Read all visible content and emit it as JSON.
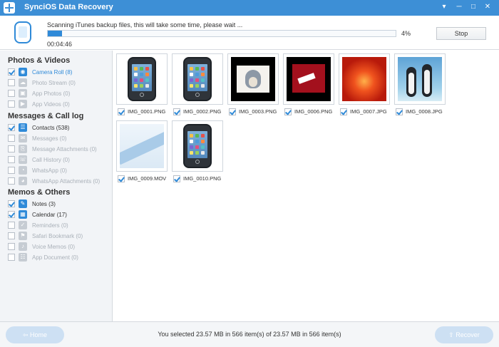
{
  "window": {
    "title": "SynciOS Data Recovery",
    "controls": [
      "▾",
      "─",
      "□",
      "✕"
    ]
  },
  "scan": {
    "message": "Scanning iTunes backup files, this will take some time, please wait ...",
    "progress_percent": 4,
    "progress_label": "4%",
    "elapsed": "00:04:46",
    "stop_label": "Stop"
  },
  "sidebar": {
    "groups": [
      {
        "title": "Photos & Videos",
        "items": [
          {
            "label": "Camera Roll (8)",
            "checked": true,
            "active": true,
            "icon": "camera-icon"
          },
          {
            "label": "Photo Stream (0)",
            "checked": false,
            "active": false,
            "icon": "photo-stream-icon"
          },
          {
            "label": "App Photos (0)",
            "checked": false,
            "active": false,
            "icon": "image-icon"
          },
          {
            "label": "App Videos (0)",
            "checked": false,
            "active": false,
            "icon": "video-icon"
          }
        ]
      },
      {
        "title": "Messages & Call log",
        "items": [
          {
            "label": "Contacts (538)",
            "checked": true,
            "active": true,
            "icon": "contacts-icon"
          },
          {
            "label": "Messages (0)",
            "checked": false,
            "active": false,
            "icon": "message-icon"
          },
          {
            "label": "Message Attachments (0)",
            "checked": false,
            "active": false,
            "icon": "attachment-icon"
          },
          {
            "label": "Call History (0)",
            "checked": false,
            "active": false,
            "icon": "phone-icon"
          },
          {
            "label": "WhatsApp (0)",
            "checked": false,
            "active": false,
            "icon": "whatsapp-icon"
          },
          {
            "label": "WhatsApp Attachments (0)",
            "checked": false,
            "active": false,
            "icon": "whatsapp-attachment-icon"
          }
        ]
      },
      {
        "title": "Memos & Others",
        "items": [
          {
            "label": "Notes (3)",
            "checked": true,
            "active": true,
            "icon": "notes-icon"
          },
          {
            "label": "Calendar (17)",
            "checked": true,
            "active": true,
            "icon": "calendar-icon"
          },
          {
            "label": "Reminders (0)",
            "checked": false,
            "active": false,
            "icon": "reminder-icon"
          },
          {
            "label": "Safari Bookmark (0)",
            "checked": false,
            "active": false,
            "icon": "bookmark-icon"
          },
          {
            "label": "Voice Memos (0)",
            "checked": false,
            "active": false,
            "icon": "microphone-icon"
          },
          {
            "label": "App Document (0)",
            "checked": false,
            "active": false,
            "icon": "document-icon"
          }
        ]
      }
    ]
  },
  "files": [
    {
      "name": "IMG_0001.PNG",
      "kind": "phone"
    },
    {
      "name": "IMG_0002.PNG",
      "kind": "phone"
    },
    {
      "name": "IMG_0003.PNG",
      "kind": "cartoon"
    },
    {
      "name": "IMG_0006.PNG",
      "kind": "sign"
    },
    {
      "name": "IMG_0007.JPG",
      "kind": "flower"
    },
    {
      "name": "IMG_0008.JPG",
      "kind": "penguins"
    },
    {
      "name": "IMG_0009.MOV",
      "kind": "film"
    },
    {
      "name": "IMG_0010.PNG",
      "kind": "phone"
    }
  ],
  "footer": {
    "home_label": "Home",
    "status": "You selected 23.57 MB in 566 item(s) of 23.57 MB in 566 item(s)",
    "recover_label": "Recover"
  }
}
